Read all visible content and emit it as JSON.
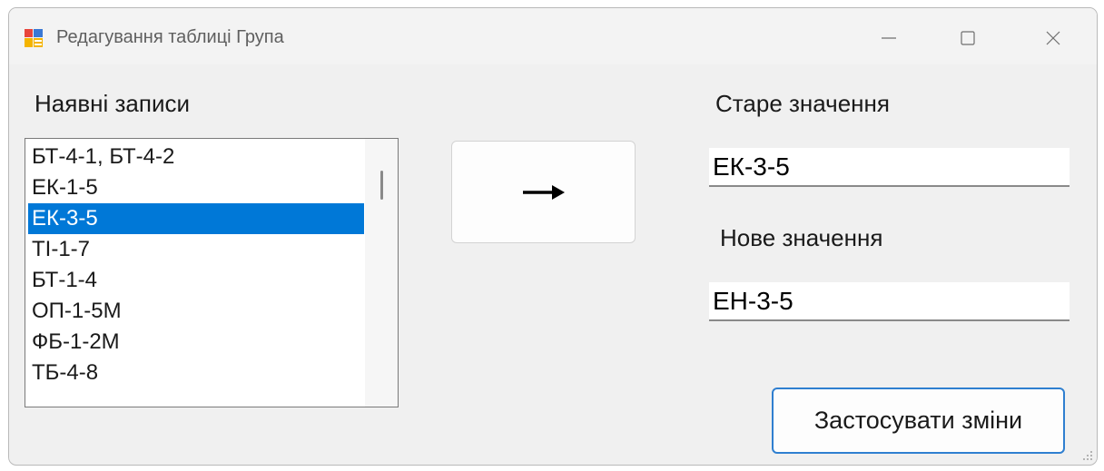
{
  "window": {
    "title": "Редагування таблиці Група",
    "icon": "app-form-icon",
    "controls": [
      "minimize-icon",
      "maximize-icon",
      "close-icon"
    ]
  },
  "existing": {
    "label": "Наявні записи",
    "items": [
      "БТ-4-1, БТ-4-2",
      "ЕК-1-5",
      "ЕК-3-5",
      "ТІ-1-7",
      "БТ-1-4",
      "ОП-1-5М",
      "ФБ-1-2М",
      "ТБ-4-8"
    ],
    "selected": "ЕК-3-5"
  },
  "transfer": {
    "icon": "arrow-right-icon"
  },
  "old_value": {
    "label": "Старе значення",
    "value": "ЕК-3-5"
  },
  "new_value": {
    "label": "Нове значення",
    "value": "ЕН-3-5"
  },
  "apply": {
    "label": "Застосувати зміни"
  },
  "colors": {
    "selection": "#0078d7",
    "focus_border": "#2f7fd0",
    "window_bg": "#f0f0f0"
  }
}
